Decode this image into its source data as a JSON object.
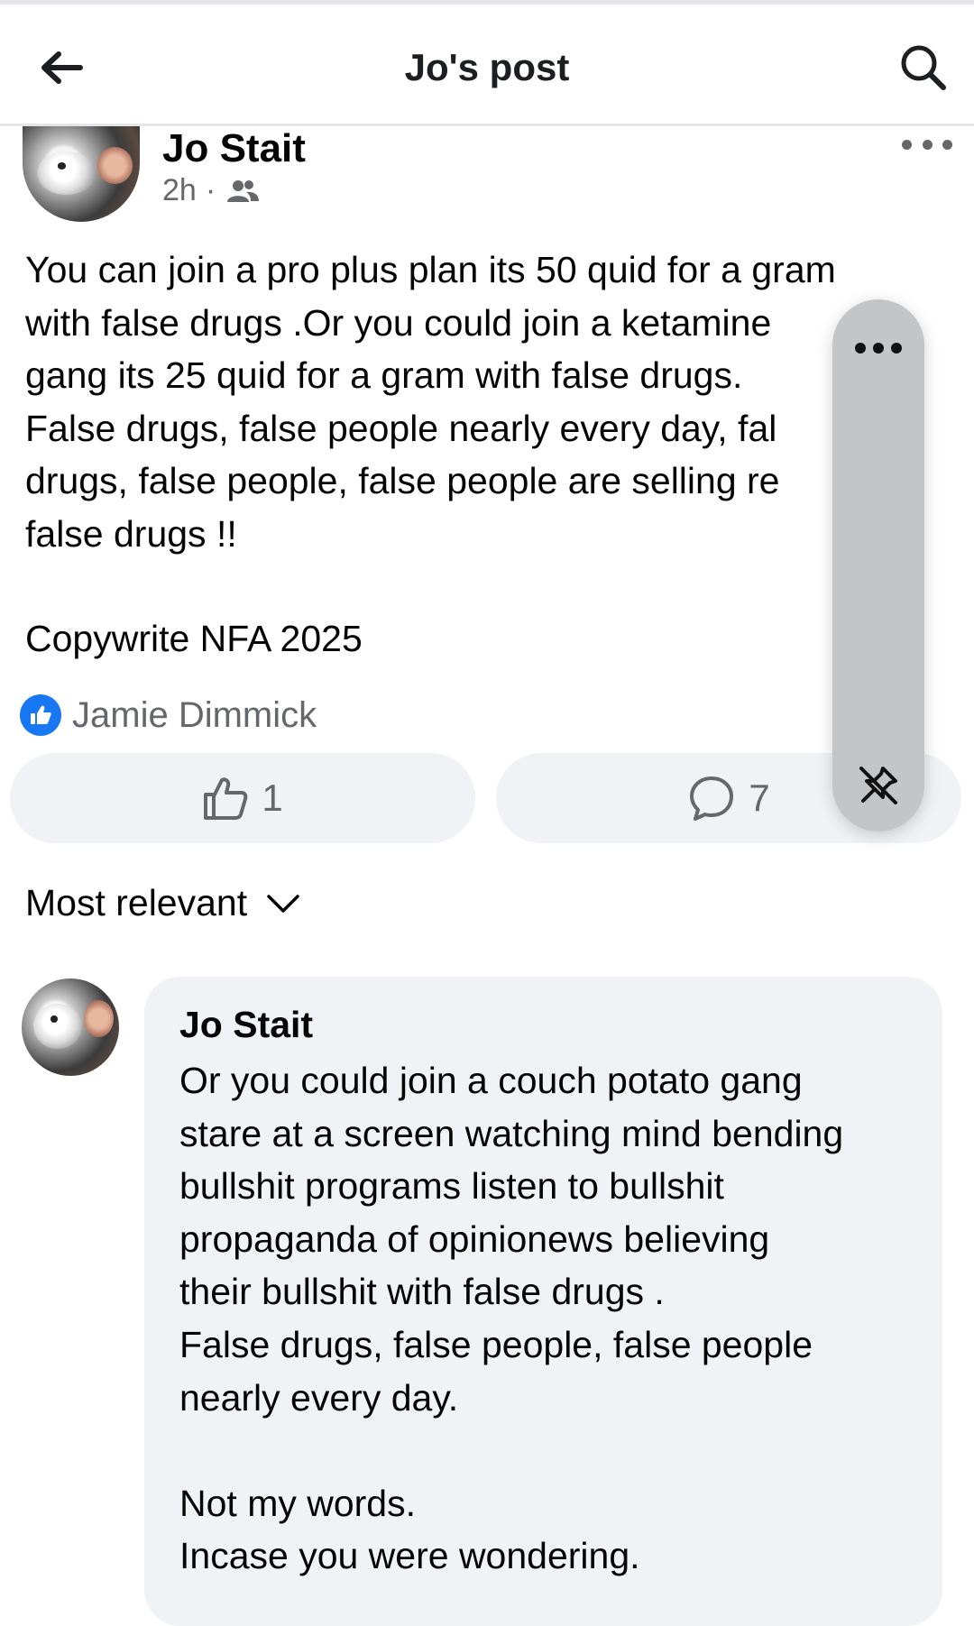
{
  "header": {
    "title": "Jo's post"
  },
  "post": {
    "author": "Jo Stait",
    "time": "2h",
    "separator": "·",
    "audience_icon": "friends-icon",
    "body": "You can join a pro plus plan its 50 quid for a gram\nwith false drugs .Or you could join a ketamine\ngang its 25 quid for a gram with false drugs.\nFalse drugs, false people nearly every day, fal\ndrugs, false people, false people are selling re\nfalse drugs !!",
    "copyright": "Copywrite NFA 2025",
    "liker": "Jamie Dimmick",
    "like_count": "1",
    "comment_count": "7"
  },
  "comments": {
    "sort_label": "Most relevant",
    "items": [
      {
        "author": "Jo Stait",
        "text": "Or you could join a couch potato gang\nstare at a screen watching mind bending\nbullshit programs listen to bullshit\npropaganda of opinionews believing\ntheir bullshit with false drugs .\nFalse drugs, false people, false people\nnearly every day.\n\nNot my words.\nIncase you were wondering."
      }
    ]
  },
  "colors": {
    "accent": "#1877f2",
    "secondary_text": "#65676b",
    "pill_bg": "#f0f2f5",
    "floating_bg": "#c4c5c7"
  }
}
